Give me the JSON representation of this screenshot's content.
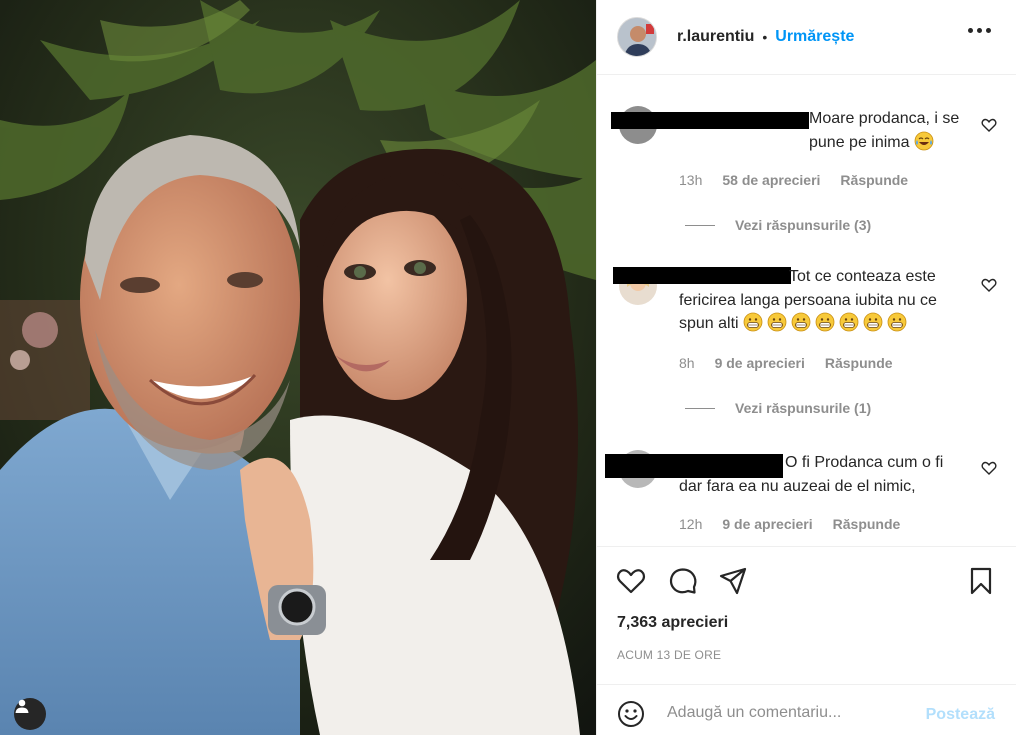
{
  "post": {
    "username": "r.laurentiu",
    "separator": "•",
    "follow_label": "Urmărește",
    "likes_count": "7,363 aprecieri",
    "posted_time": "ACUM 13 DE ORE"
  },
  "comments": [
    {
      "text": "Moare prodanca, i se pune pe inima",
      "emoji": "tears-of-joy",
      "time": "13h",
      "likes": "58 de aprecieri",
      "reply_label": "Răspunde",
      "view_replies": "Vezi răspunsurile (3)"
    },
    {
      "text": "Tot ce conteaza este fericirea langa persoana iubita nu ce spun alti",
      "emoji": "grin",
      "emoji_count": 7,
      "time": "8h",
      "likes": "9 de aprecieri",
      "reply_label": "Răspunde",
      "view_replies": "Vezi răspunsurile (1)"
    },
    {
      "text": "O fi Prodanca cum o fi dar fara ea nu auzeai de el nimic,",
      "time": "12h",
      "likes": "9 de aprecieri",
      "reply_label": "Răspunde"
    }
  ],
  "composer": {
    "placeholder": "Adaugă un comentariu...",
    "post_label": "Postează"
  },
  "icons": {
    "more": "more-horizontal-icon",
    "like": "heart-icon",
    "comment": "comment-bubble-icon",
    "share": "paper-plane-icon",
    "save": "bookmark-icon",
    "emoji": "smiley-icon",
    "tag": "user-tag-icon"
  },
  "colors": {
    "accent": "#0095f6",
    "post_disabled": "#b2dffc",
    "muted": "#8e8e8e",
    "text": "#262626",
    "border": "#efefef"
  }
}
